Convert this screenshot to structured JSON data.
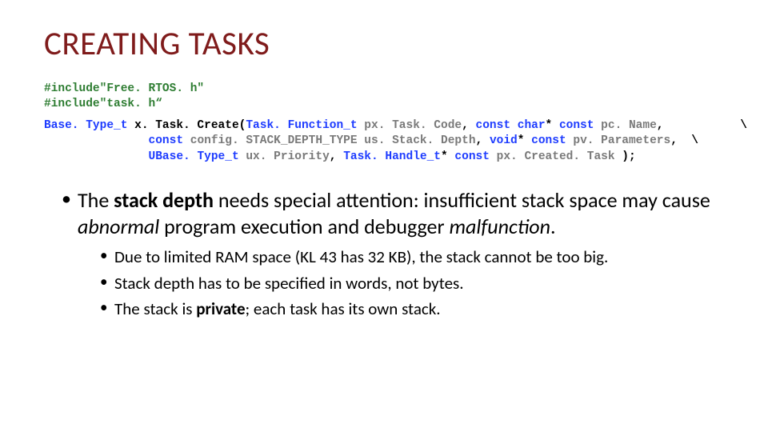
{
  "title": "CREATING TASKS",
  "code": {
    "inc1": "#include\"Free. RTOS. h\"",
    "inc2": "#include\"task. h“",
    "fn": {
      "l1_a": "Base. Type_t",
      "l1_b": " x. Task. Create",
      "l1_c": "(",
      "l1_d": "Task. Function_t",
      "l1_e": " px. Task. Code",
      "l1_f": ", ",
      "l1_g": "const char",
      "l1_h": "* ",
      "l1_i": "const",
      "l1_j": " pc. Name",
      "l1_k": ",           \\",
      "l2_a": "               ",
      "l2_b": "const",
      "l2_c": " config. STACK_DEPTH_TYPE",
      "l2_d": " us. Stack. Depth",
      "l2_e": ", ",
      "l2_f": "void",
      "l2_g": "* ",
      "l2_h": "const",
      "l2_i": " pv. Parameters",
      "l2_j": ",  \\",
      "l3_a": "               ",
      "l3_b": "UBase. Type_t",
      "l3_c": " ux. Priority",
      "l3_d": ", ",
      "l3_e": "Task. Handle_t",
      "l3_f": "* ",
      "l3_g": "const",
      "l3_h": " px. Created. Task",
      "l3_i": " );"
    }
  },
  "bullet_main": {
    "p1": "The ",
    "p2_bold": "stack depth",
    "p3": " needs special attention: insufficient stack space may cause ",
    "p4_ital": "abnormal",
    "p5": " program execution and debugger ",
    "p6_ital": "malfunction",
    "p7": "."
  },
  "sub": {
    "s1_a": "Due to limited RAM space (KL 43 has 32 KB), the stack cannot be too big.",
    "s2_a": "Stack depth has to be specified in words, not bytes.",
    "s3_a": "The stack is ",
    "s3_b_bold": "private",
    "s3_c": "; each task has its own stack."
  }
}
